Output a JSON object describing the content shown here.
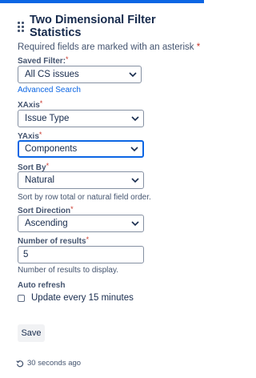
{
  "gadget": {
    "title": "Two Dimensional Filter Statistics"
  },
  "form": {
    "required_note": "Required fields are marked with an asterisk",
    "required_star": "*",
    "saved_filter": {
      "label": "Saved Filter:",
      "value": "All CS issues",
      "link": "Advanced Search"
    },
    "xaxis": {
      "label": "XAxis",
      "value": "Issue Type"
    },
    "yaxis": {
      "label": "YAxis",
      "value": "Components"
    },
    "sort_by": {
      "label": "Sort By",
      "value": "Natural",
      "help": "Sort by row total or natural field order."
    },
    "sort_direction": {
      "label": "Sort Direction",
      "value": "Ascending"
    },
    "num_results": {
      "label": "Number of results",
      "value": "5",
      "help": "Number of results to display."
    },
    "auto_refresh": {
      "label": "Auto refresh",
      "checkbox_label": "Update every 15 minutes",
      "checked": false
    },
    "save_label": "Save"
  },
  "footer": {
    "last_refreshed": "30 seconds ago"
  },
  "colors": {
    "accent": "#0c66e4",
    "required": "#c9372c",
    "text": "#172b4d",
    "subtle": "#44546f"
  }
}
